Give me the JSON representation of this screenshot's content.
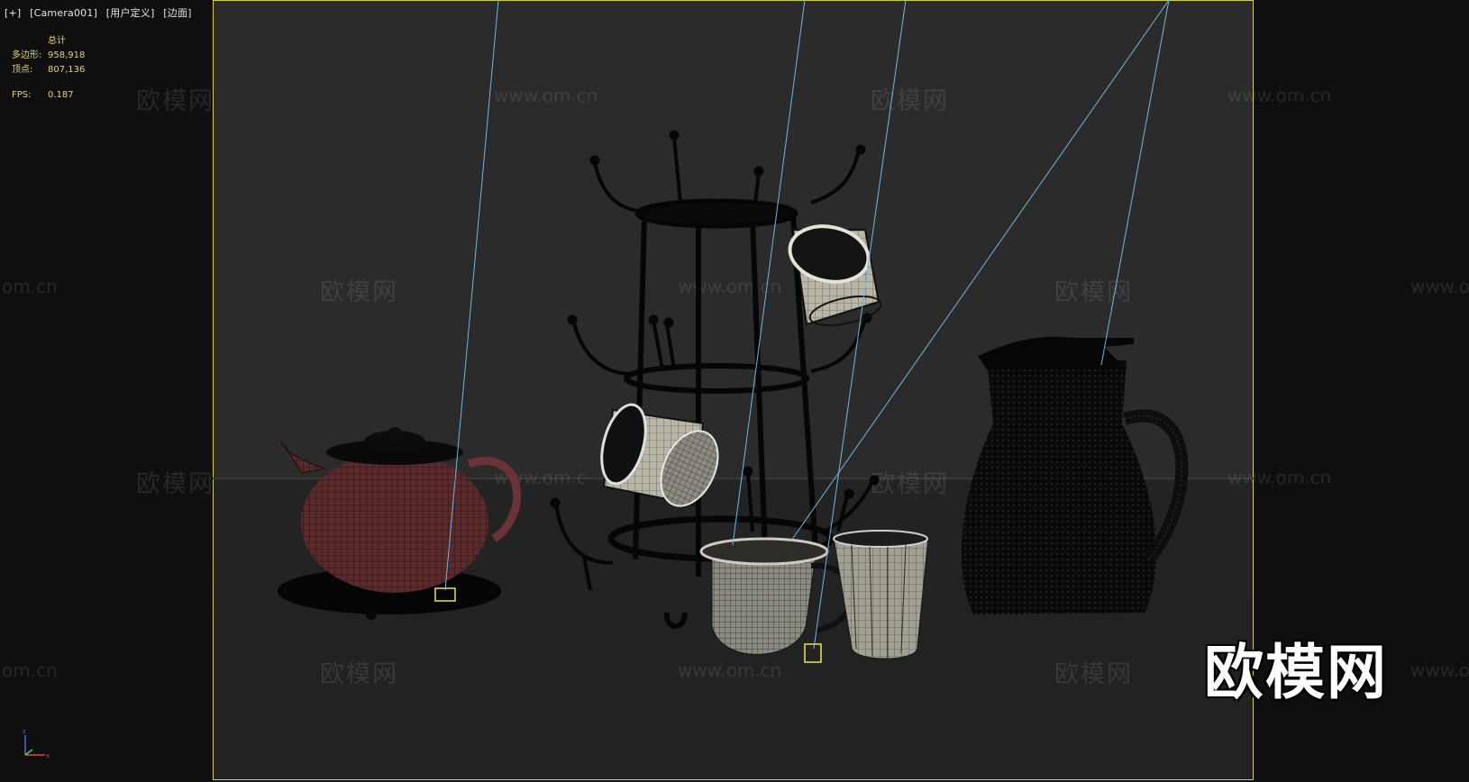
{
  "viewport": {
    "label_items": [
      "[+]",
      "[Camera001]",
      "[用户定义]",
      "[边面]"
    ]
  },
  "stats": {
    "header": "总计",
    "polygons_label": "多边形:",
    "polygons_value": "958,918",
    "vertices_label": "顶点:",
    "vertices_value": "807,136",
    "fps_label": "FPS:",
    "fps_value": "0.187"
  },
  "watermarks": {
    "cn": "欧模网",
    "url": "www.om.cn",
    "url_partial": "www.om.c",
    "url_tail": "om.cn",
    "url_head": "www.o"
  },
  "logo": "欧模网",
  "colors": {
    "frame": "#cfcf3c",
    "stats_text": "#e5d36b",
    "camera_line": "#6db7e6"
  }
}
